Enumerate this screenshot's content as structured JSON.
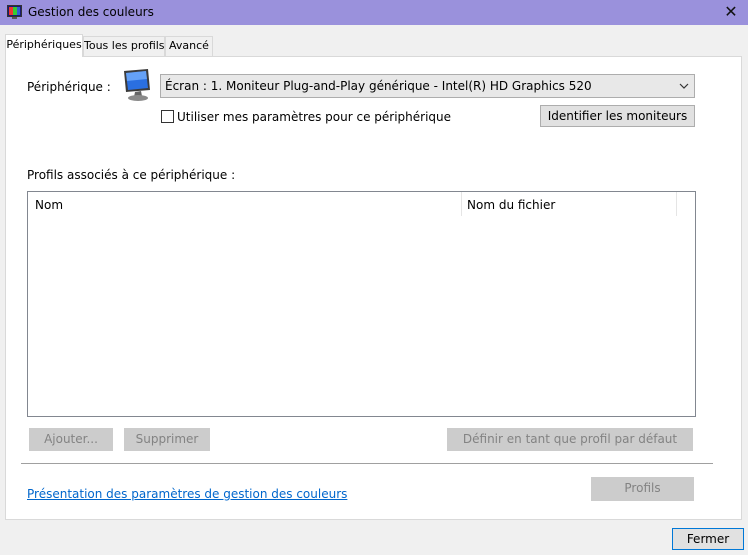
{
  "window": {
    "title": "Gestion des couleurs",
    "close_glyph": "✕",
    "icon": "color-management-icon"
  },
  "tabs": [
    {
      "label": "Périphériques",
      "active": true
    },
    {
      "label": "Tous les profils",
      "active": false
    },
    {
      "label": "Avancé",
      "active": false
    }
  ],
  "device": {
    "label": "Périphérique :",
    "icon": "monitor-icon",
    "selected": "Écran : 1. Moniteur Plug-and-Play générique - Intel(R) HD Graphics 520",
    "use_settings_checkbox": {
      "label": "Utiliser mes paramètres pour ce périphérique",
      "checked": false
    },
    "identify_button": "Identifier les moniteurs"
  },
  "profiles": {
    "section_label": "Profils associés à ce périphérique :",
    "columns": [
      "Nom",
      "Nom du fichier"
    ],
    "rows": []
  },
  "actions": {
    "add": "Ajouter...",
    "remove": "Supprimer",
    "set_default": "Définir en tant que profil par défaut"
  },
  "footer": {
    "link": "Présentation des paramètres de gestion des couleurs",
    "profiles_button": "Profils",
    "close_button": "Fermer"
  },
  "colors": {
    "titlebar": "#9a91dc",
    "link": "#0066cc",
    "focus_border": "#0078d7"
  }
}
